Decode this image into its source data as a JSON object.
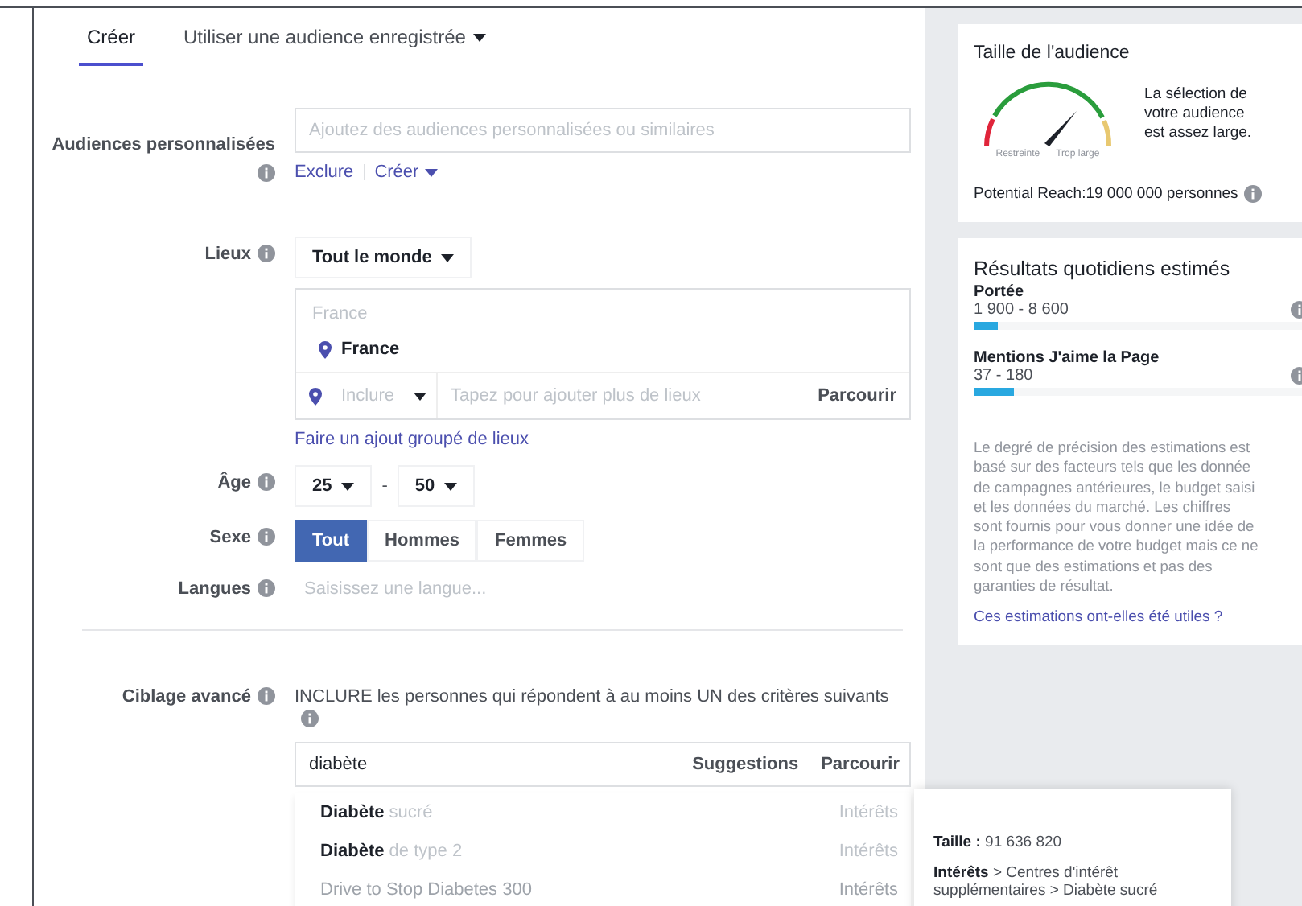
{
  "tabs": [
    {
      "label": "Créer",
      "selected": true,
      "caret": false
    },
    {
      "label": "Utiliser une audience enregistrée",
      "selected": false,
      "caret": true
    }
  ],
  "form": {
    "custom_audiences": {
      "label": "Audiences personnalisées",
      "placeholder": "Ajoutez des audiences personnalisées ou similaires",
      "links": [
        {
          "label": "Exclure",
          "caret": false
        },
        {
          "label": "Créer",
          "caret": true
        }
      ]
    },
    "locations": {
      "label": "Lieux",
      "dropdown": "Tout le monde",
      "group_heading": "France",
      "items": [
        "France"
      ],
      "mode": "Inclure",
      "placeholder": "Tapez pour ajouter plus de lieux",
      "browse": "Parcourir",
      "bulk_link": "Faire un ajout groupé de lieux"
    },
    "age": {
      "label": "Âge",
      "from": "25",
      "separator": "-",
      "to": "50"
    },
    "gender": {
      "label": "Sexe",
      "options": [
        {
          "label": "Tout",
          "selected": true
        },
        {
          "label": "Hommes",
          "selected": false
        },
        {
          "label": "Femmes",
          "selected": false
        }
      ]
    },
    "languages": {
      "label": "Langues",
      "placeholder": "Saisissez une langue..."
    },
    "detailed_targeting": {
      "label": "Ciblage avancé",
      "instruction": "INCLURE les personnes qui répondent à au moins UN des critères suivants",
      "query": "diabète",
      "tabs": [
        "Suggestions",
        "Parcourir"
      ],
      "results": [
        {
          "name": "**Diabète** sucré",
          "category": "Intérêts",
          "disabled": false
        },
        {
          "name": "**Diabète** de type 2",
          "category": "Intérêts",
          "disabled": false
        },
        {
          "name": "Drive to Stop Diabetes 300",
          "category": "Intérêts",
          "disabled": true
        }
      ]
    }
  },
  "audience_size": {
    "title": "Taille de l'audience",
    "gauge_labels": [
      "Restreinte",
      "Trop large"
    ],
    "message": "La sélection de\nvotre audience\nest assez large.",
    "reach": "Potential Reach:19 000 000 personnes"
  },
  "estimates": {
    "title": "Résultats quotidiens estimés",
    "metrics": [
      {
        "name": "Portée",
        "range": "1 900 - 8 600",
        "level": 0.07
      },
      {
        "name": "Mentions J'aime la Page",
        "range": "37 - 180",
        "level": 0.12
      }
    ],
    "note": "Le degré de précision des estimations est\nbasé sur des facteurs tels que les donnée\nde campagnes antérieures, le budget saisi\net les données du marché. Les chiffres\nsont fournis pour vous donner une idée de\nla performance de votre budget mais ce ne\nsont que des estimations et pas des\ngaranties de résultat.",
    "feedback_link": "Ces estimations ont-elles été utiles ?"
  },
  "tooltip": {
    "size": "**Taille :** 91 636 820",
    "path": "**Intérêts** > Centres d'intérêt supplémentaires > Diabète sucré"
  }
}
